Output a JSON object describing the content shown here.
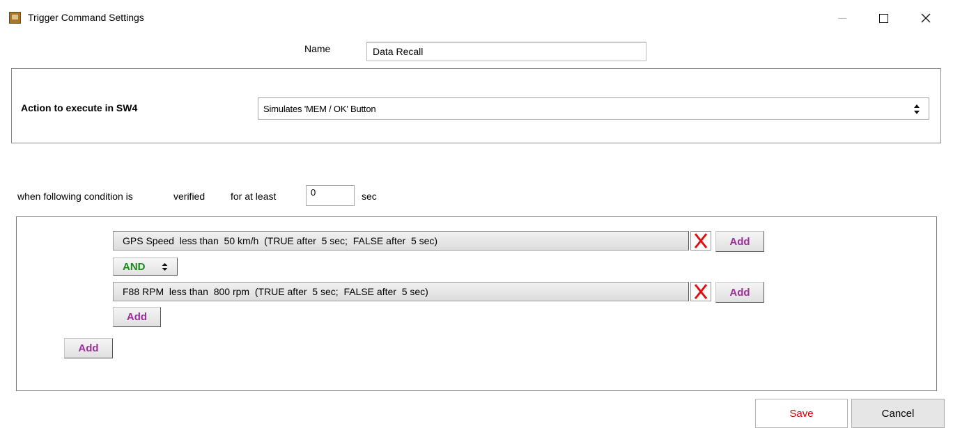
{
  "window": {
    "title": "Trigger Command Settings",
    "icon": "app-icon"
  },
  "name_field": {
    "label": "Name",
    "value": "Data Recall"
  },
  "action": {
    "label": "Action to execute in SW4",
    "selected": "Simulates 'MEM / OK' Button"
  },
  "condition": {
    "prefix": "when following condition is",
    "mode": "verified",
    "duration_label": "for at least",
    "seconds": "0",
    "unit": "sec"
  },
  "rules": [
    {
      "text": "GPS Speed  less than  50 km/h  (TRUE after  5 sec;  FALSE after  5 sec)",
      "add_label": "Add"
    },
    {
      "text": "F88 RPM  less than  800 rpm  (TRUE after  5 sec;  FALSE after  5 sec)",
      "add_label": "Add"
    }
  ],
  "operator": "AND",
  "group_add_label": "Add",
  "outer_add_label": "Add",
  "buttons": {
    "save": "Save",
    "cancel": "Cancel"
  },
  "colors": {
    "add_text": "#9b2f9b",
    "and_text": "#188a18",
    "delete_x": "#e01010",
    "save_text": "#d10000"
  }
}
